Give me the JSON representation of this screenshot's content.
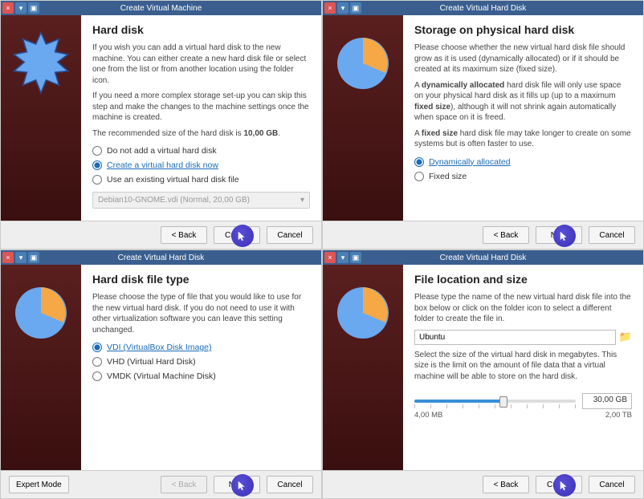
{
  "p1": {
    "title": "Create Virtual Machine",
    "heading": "Hard disk",
    "para1": "If you wish you can add a virtual hard disk to the new machine. You can either create a new hard disk file or select one from the list or from another location using the folder icon.",
    "para2": "If you need a more complex storage set-up you can skip this step and make the changes to the machine settings once the machine is created.",
    "para3_pre": "The recommended size of the hard disk is ",
    "para3_bold": "10,00 GB",
    "para3_post": ".",
    "r1": "Do not add a virtual hard disk",
    "r2": "Create a virtual hard disk now",
    "r3": "Use an existing virtual hard disk file",
    "dropdown": "Debian10-GNOME.vdi (Normal, 20,00 GB)",
    "back": "< Back",
    "next": "Create",
    "cancel": "Cancel"
  },
  "p2": {
    "title": "Create Virtual Hard Disk",
    "heading": "Storage on physical hard disk",
    "para1": "Please choose whether the new virtual hard disk file should grow as it is used (dynamically allocated) or if it should be created at its maximum size (fixed size).",
    "para2a": "A ",
    "para2b": "dynamically allocated",
    "para2c": " hard disk file will only use space on your physical hard disk as it fills up (up to a maximum ",
    "para2d": "fixed size",
    "para2e": "), although it will not shrink again automatically when space on it is freed.",
    "para3a": "A ",
    "para3b": "fixed size",
    "para3c": " hard disk file may take longer to create on some systems but is often faster to use.",
    "r1": "Dynamically allocated",
    "r2": "Fixed size",
    "back": "< Back",
    "next": "Next",
    "cancel": "Cancel"
  },
  "p3": {
    "title": "Create Virtual Hard Disk",
    "heading": "Hard disk file type",
    "para1": "Please choose the type of file that you would like to use for the new virtual hard disk. If you do not need to use it with other virtualization software you can leave this setting unchanged.",
    "r1": "VDI (VirtualBox Disk Image)",
    "r2": "VHD (Virtual Hard Disk)",
    "r3": "VMDK (Virtual Machine Disk)",
    "expert": "Expert Mode",
    "back": "< Back",
    "next": "Next",
    "cancel": "Cancel"
  },
  "p4": {
    "title": "Create Virtual Hard Disk",
    "heading": "File location and size",
    "para1": "Please type the name of the new virtual hard disk file into the box below or click on the folder icon to select a different folder to create the file in.",
    "filename": "Ubuntu",
    "para2": "Select the size of the virtual hard disk in megabytes. This size is the limit on the amount of file data that a virtual machine will be able to store on the hard disk.",
    "size": "30,00 GB",
    "min": "4,00 MB",
    "max": "2,00 TB",
    "back": "< Back",
    "next": "Create",
    "cancel": "Cancel"
  }
}
